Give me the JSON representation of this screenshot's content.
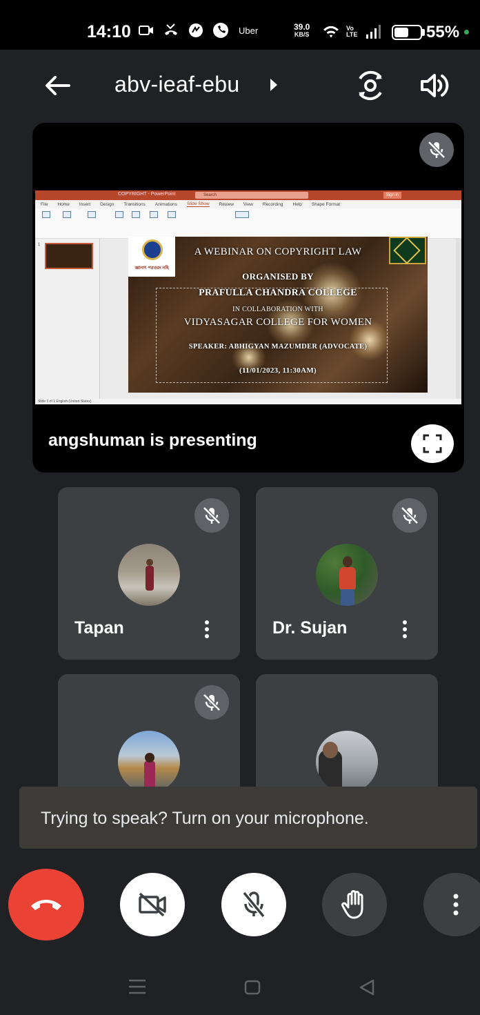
{
  "status_bar": {
    "time": "14:10",
    "uber_label": "Uber",
    "net_speed_value": "39.0",
    "net_speed_unit": "KB/S",
    "volte_label": "Vo LTE",
    "battery_percent": "55%",
    "battery_level": 0.55,
    "icons": [
      "video-icon",
      "missed-call-icon",
      "share-icon",
      "phone-icon",
      "wifi-icon",
      "signal-icon",
      "battery-icon"
    ]
  },
  "app_bar": {
    "meeting_code": "abv-ieaf-ebu",
    "icons": [
      "back-arrow-icon",
      "chevron-right-icon",
      "switch-camera-icon",
      "speaker-icon"
    ]
  },
  "presentation": {
    "presenter_label": "angshuman is presenting",
    "shared_app": {
      "window_title": "COPYRIGHT - PowerPoint",
      "search_placeholder": "Search",
      "sign_in": "Sign in",
      "menu_tabs": [
        "File",
        "Home",
        "Insert",
        "Design",
        "Transitions",
        "Animations",
        "Slide Show",
        "Review",
        "View",
        "Recording",
        "Help",
        "Shape Format"
      ],
      "active_tab": "Slide Show",
      "status_text": "Slide 1 of 1    English (United States)"
    },
    "slide": {
      "logo_text": "জ্ঞানাৎ পরতরং নহি",
      "line1": "A WEBINAR ON COPYRIGHT LAW",
      "line2": "ORGANISED BY",
      "line3": "PRAFULLA CHANDRA COLLEGE",
      "line4": "IN COLLABORATION WITH",
      "line5": "VIDYASAGAR COLLEGE FOR  WOMEN",
      "line6": "SPEAKER: ABHIGYAN MAZUMDER (ADVOCATE)",
      "line7": "(11/01/2023, 11:30AM)"
    }
  },
  "participants": [
    {
      "name": "Tapan",
      "muted": true
    },
    {
      "name": "Dr. Sujan",
      "muted": true
    },
    {
      "name": "",
      "muted": true
    },
    {
      "name": "",
      "muted": false
    }
  ],
  "snackbar": {
    "message": "Trying to speak? Turn on your microphone."
  },
  "controls": {
    "icons": [
      "end-call-icon",
      "camera-off-icon",
      "mic-off-icon",
      "raise-hand-icon",
      "more-vert-icon"
    ]
  },
  "colors": {
    "background": "#202124",
    "tile": "#3c4043",
    "end_call": "#ea4335",
    "mute_badge": "#5f6368",
    "snackbar": "#3c3b37",
    "status_dot": "#34a853"
  }
}
